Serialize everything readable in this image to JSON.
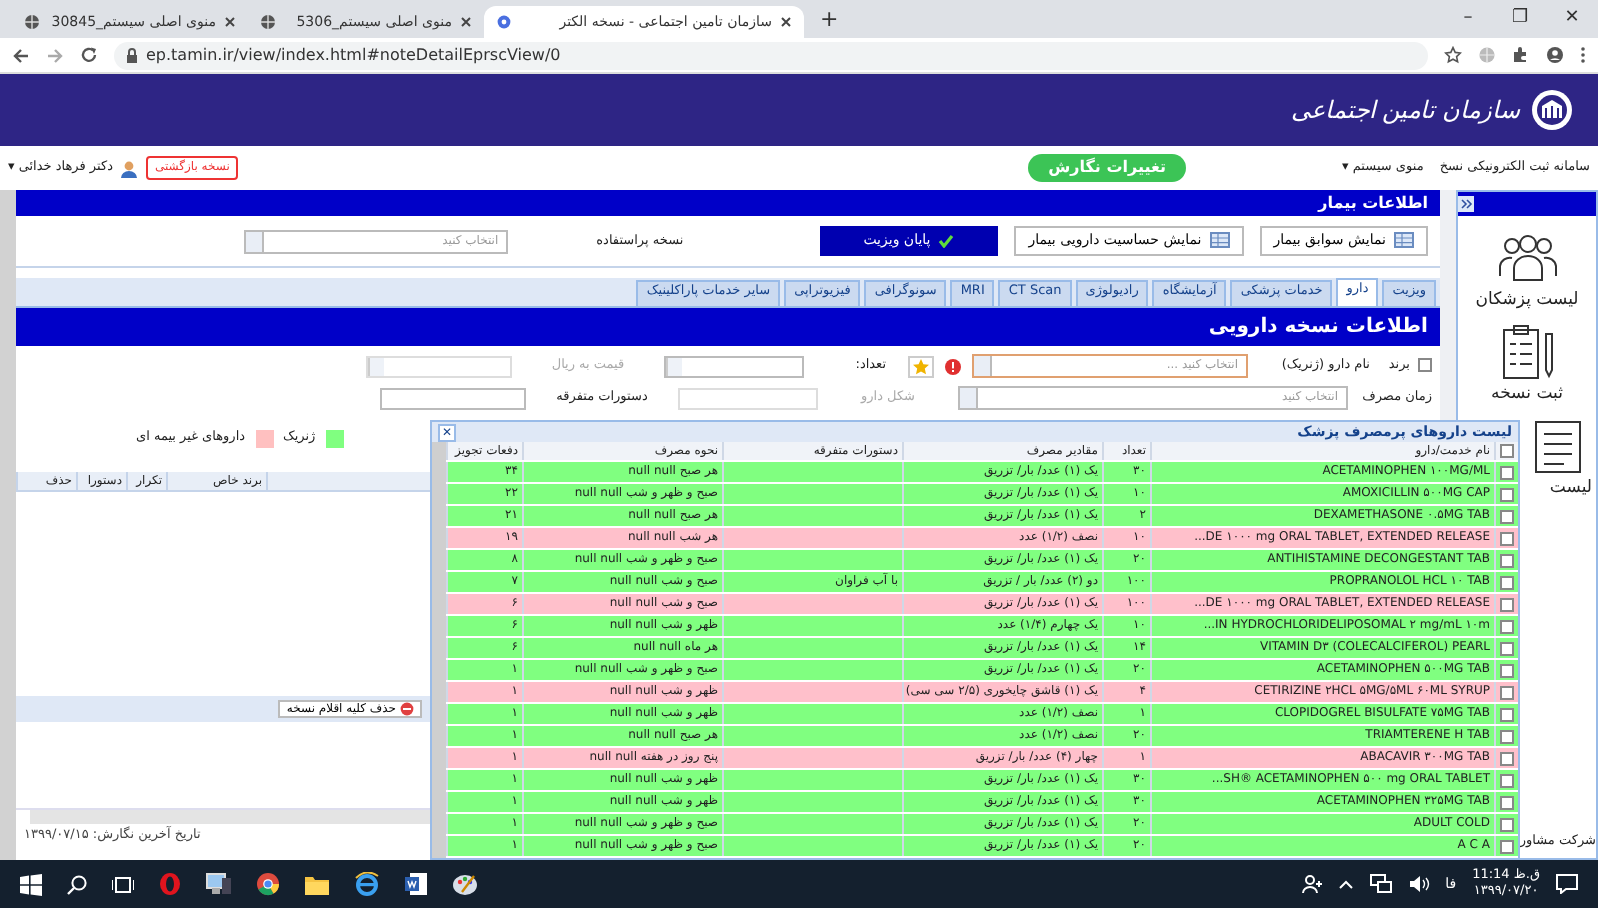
{
  "browser": {
    "tabs": [
      {
        "title": "سازمان تامین اجتماعی - نسخه الکتر",
        "selected": true
      },
      {
        "title": "منوی اصلی سیستم_5306",
        "selected": false
      },
      {
        "title": "منوی اصلی سیستم_30845",
        "selected": false
      }
    ],
    "new_tab": "+",
    "window_controls": [
      "✕",
      "❐",
      "–"
    ],
    "url": "ep.tamin.ir/view/index.html#noteDetailEprscView/0"
  },
  "header": {
    "logo_text": "سازمان تامین اجتماعی"
  },
  "toolbar": {
    "system_name": "سامانه ثبت الکترونیکی نسخ",
    "menu": "منوی سیستم ▾",
    "changes_button": "تغییرات نگارش",
    "returned_button": "نسخه بازگشتی",
    "user": "دکتر فرهاد خدائی ▾"
  },
  "patient": {
    "title": "اطلاعات بیمار",
    "history_button": "نمایش سوابق بیمار",
    "allergy_button": "نمایش حساسیت دارویی بیمار",
    "end_visit_button": "پایان ویزیت",
    "frequent_label": "نسخه پراستفاده",
    "frequent_placeholder": "انتخاب کنید"
  },
  "tabs": [
    {
      "label": "ویزیت",
      "selected": false
    },
    {
      "label": "دارو",
      "selected": true
    },
    {
      "label": "خدمات پزشکی",
      "selected": false
    },
    {
      "label": "آزمایشگاه",
      "selected": false
    },
    {
      "label": "رادیولوژی",
      "selected": false
    },
    {
      "label": "CT Scan",
      "selected": false
    },
    {
      "label": "MRI",
      "selected": false
    },
    {
      "label": "سونوگرافی",
      "selected": false
    },
    {
      "label": "فیزیوتراپی",
      "selected": false
    },
    {
      "label": "سایر خدمات پاراکلینیک",
      "selected": false
    }
  ],
  "prescription": {
    "title": "اطلاعات نسخه دارویی",
    "brand_label": "برند",
    "brand_checked": false,
    "drug_label": "نام دارو (ژنریک)",
    "drug_placeholder": "انتخاب کنید ...",
    "count_label": "تعداد:",
    "price_label": "قیمت به ریال",
    "time_label": "زمان مصرف",
    "time_placeholder": "انتخاب کنید",
    "form_label": "شکل دارو",
    "misc_label": "دستورات متفرقه",
    "legend": [
      {
        "label": "ژنریک",
        "color": "#80ff80"
      },
      {
        "label": "داروهای غیر بیمه ای",
        "color": "#ffc0c0"
      }
    ]
  },
  "items_grid": {
    "columns": [
      "برند خاص",
      "تکرار",
      "دستورا",
      "حذف"
    ],
    "delete_all_button": "حذف کلیه اقلام نسخه",
    "last_edit": "تاریخ آخرین نگارش: ۱۳۹۹/۰۷/۱۵"
  },
  "sidebar": {
    "items": [
      {
        "label": "لیست پزشکان",
        "kind": "doctors"
      },
      {
        "label": "ثبت نسخه",
        "kind": "prescription"
      },
      {
        "label": "لیست",
        "kind": "list"
      }
    ],
    "footer": "شرکت مشاور"
  },
  "dialog": {
    "title": "لیست داروهای پرمصرف پزشک",
    "close": "✕",
    "select_all_checked": false,
    "columns": [
      "نام خدمت/دارو",
      "تعداد",
      "مقادیر مصرف",
      "دستورات متفرقه",
      "نحوه مصرف",
      "دفعات تجویز"
    ],
    "rows": [
      {
        "name": "ACETAMINOPHEN ۱۰۰MG/ML",
        "count": "۳۰",
        "dosage": "یک (۱) عدد/ بار/ تزریق",
        "instructions": "",
        "usage": "هر صبح null null",
        "times": "۳۴",
        "insured": true,
        "checked": false
      },
      {
        "name": "AMOXICILLIN ۵۰۰MG CAP",
        "count": "۱۰",
        "dosage": "یک (۱) عدد/ بار/ تزریق",
        "instructions": "",
        "usage": "صبح و ظهر و شب null null",
        "times": "۲۲",
        "insured": true,
        "checked": false
      },
      {
        "name": "DEXAMETHASONE ۰.۵MG TAB",
        "count": "۲",
        "dosage": "یک (۱) عدد/ بار/ تزریق",
        "instructions": "",
        "usage": "هر صبح null null",
        "times": "۲۱",
        "insured": true,
        "checked": false
      },
      {
        "name": "...DE ۱۰۰۰ mg ORAL TABLET, EXTENDED RELEASE",
        "count": "۱۰",
        "dosage": "نصف (۱/۲) عدد",
        "instructions": "",
        "usage": "هر شب null null",
        "times": "۱۹",
        "insured": false,
        "checked": false
      },
      {
        "name": "ANTIHISTAMINE DECONGESTANT TAB",
        "count": "۲۰",
        "dosage": "یک (۱) عدد/ بار/ تزریق",
        "instructions": "",
        "usage": "صبح و ظهر و شب null null",
        "times": "۸",
        "insured": true,
        "checked": false
      },
      {
        "name": "PROPRANOLOL HCL ۱۰ TAB",
        "count": "۱۰۰",
        "dosage": "دو (۲) عدد/ بار / تزریق",
        "instructions": "با آب فراوان",
        "usage": "صبح و شب null null",
        "times": "۷",
        "insured": true,
        "checked": false
      },
      {
        "name": "...DE ۱۰۰۰ mg ORAL TABLET, EXTENDED RELEASE",
        "count": "۱۰۰",
        "dosage": "یک (۱) عدد/ بار/ تزریق",
        "instructions": "",
        "usage": "صبح و شب null null",
        "times": "۶",
        "insured": false,
        "checked": false
      },
      {
        "name": "...IN HYDROCHLORIDELIPOSOMAL ۲ mg/mL ۱۰m",
        "count": "۱۰",
        "dosage": "یک چهارم (۱/۴) عدد",
        "instructions": "",
        "usage": "ظهر و شب null null",
        "times": "۶",
        "insured": true,
        "checked": false
      },
      {
        "name": "VITAMIN D۳ (COLECALCIFEROL) PEARL",
        "count": "۱۴",
        "dosage": "یک (۱) عدد/ بار/ تزریق",
        "instructions": "",
        "usage": "هر ماه null null",
        "times": "۶",
        "insured": true,
        "checked": false
      },
      {
        "name": "ACETAMINOPHEN ۵۰۰MG TAB",
        "count": "۲۰",
        "dosage": "یک (۱) عدد/ بار/ تزریق",
        "instructions": "",
        "usage": "صبح و ظهر و شب null null",
        "times": "۱",
        "insured": true,
        "checked": false
      },
      {
        "name": "CETIRIZINE ۲HCL ۵MG/۵ML ۶۰ML SYRUP",
        "count": "۴",
        "dosage": "یک (۱) قاشق چایخوری (۲/۵ سی سی)",
        "instructions": "",
        "usage": "ظهر و شب null null",
        "times": "۱",
        "insured": false,
        "checked": false
      },
      {
        "name": "CLOPIDOGREL BISULFATE ۷۵MG TAB",
        "count": "۱",
        "dosage": "نصف (۱/۲) عدد",
        "instructions": "",
        "usage": "ظهر و شب null null",
        "times": "۱",
        "insured": true,
        "checked": false
      },
      {
        "name": "TRIAMTERENE H TAB",
        "count": "۲۰",
        "dosage": "نصف (۱/۲) عدد",
        "instructions": "",
        "usage": "هر صبح null null",
        "times": "۱",
        "insured": true,
        "checked": false
      },
      {
        "name": "ABACAVIR ۳۰۰MG TAB",
        "count": "۱",
        "dosage": "چهار (۴) عدد/ بار/ تزریق",
        "instructions": "",
        "usage": "پنج روز در هفته null null",
        "times": "۱",
        "insured": false,
        "checked": false
      },
      {
        "name": "...SH® ACETAMINOPHEN ۵۰۰ mg ORAL TABLET",
        "count": "۳۰",
        "dosage": "یک (۱) عدد/ بار/ تزریق",
        "instructions": "",
        "usage": "ظهر و شب null null",
        "times": "۱",
        "insured": true,
        "checked": false
      },
      {
        "name": "ACETAMINOPHEN ۳۲۵MG TAB",
        "count": "۳۰",
        "dosage": "یک (۱) عدد/ بار/ تزریق",
        "instructions": "",
        "usage": "ظهر و شب null null",
        "times": "۱",
        "insured": true,
        "checked": false
      },
      {
        "name": "ADULT COLD",
        "count": "۲۰",
        "dosage": "یک (۱) عدد/ بار/ تزریق",
        "instructions": "",
        "usage": "صبح و ظهر و شب null null",
        "times": "۱",
        "insured": true,
        "checked": false
      },
      {
        "name": "A C A",
        "count": "۲۰",
        "dosage": "یک (۱) عدد/ بار/ تزریق",
        "instructions": "",
        "usage": "صبح و ظهر و شب null null",
        "times": "۱",
        "insured": true,
        "checked": false
      }
    ]
  },
  "taskbar": {
    "lang": "فا",
    "time": "11:14 ق.ظ",
    "date": "۱۳۹۹/۰۷/۲۰"
  }
}
